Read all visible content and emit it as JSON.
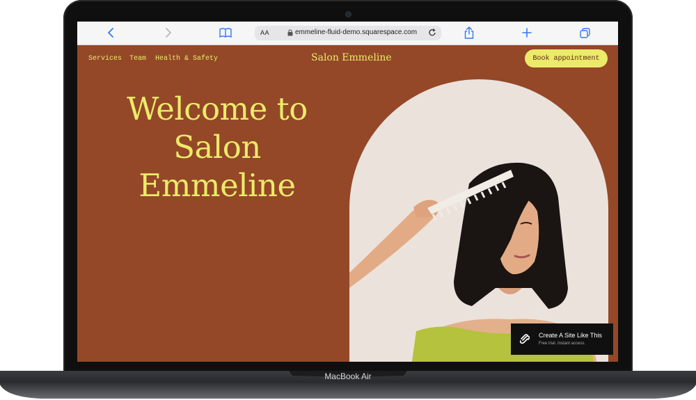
{
  "device": {
    "label": "MacBook Air"
  },
  "browser": {
    "url": "emmeline-fluid-demo.squarespace.com",
    "reader_label": "AA",
    "icons": [
      "chevron-left-icon",
      "chevron-right-icon",
      "book-icon",
      "lock-icon",
      "reload-icon",
      "share-icon",
      "plus-icon",
      "tabs-icon"
    ]
  },
  "site": {
    "nav": [
      "Services",
      "Team",
      "Health & Safety"
    ],
    "brand": "Salon Emmeline",
    "cta": "Book appointment",
    "hero": [
      "Welcome to",
      "Salon",
      "Emmeline"
    ]
  },
  "badge": {
    "title": "Create A Site Like This",
    "subtitle": "Free trial. Instant access."
  },
  "colors": {
    "background": "#944828",
    "accent": "#ecea6a",
    "arch": "#ece2dc",
    "browser_blue": "#3478f6"
  }
}
